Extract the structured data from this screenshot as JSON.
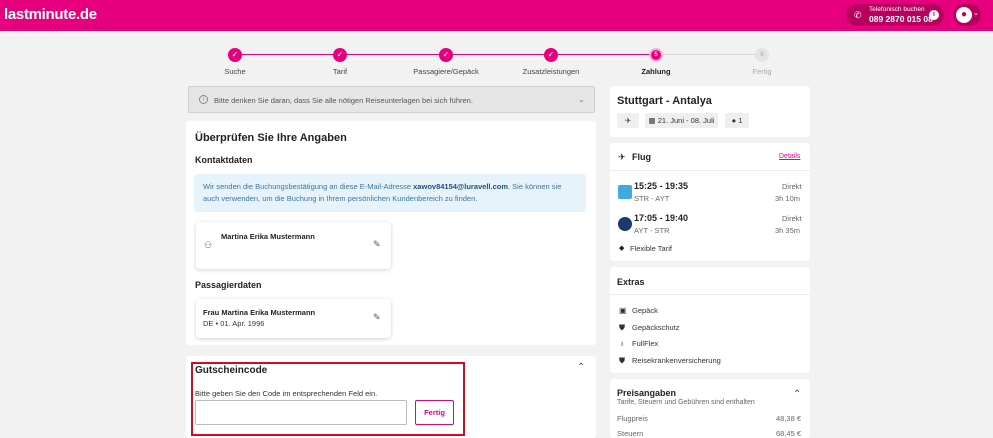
{
  "header": {
    "logo": "lastminute.de",
    "phone_label": "Telefonisch buchen",
    "phone_number": "089 2870 015 08"
  },
  "steps": [
    {
      "label": "Suche",
      "symbol": "✓"
    },
    {
      "label": "Tarif",
      "symbol": "✓"
    },
    {
      "label": "Passagiere/Gepäck",
      "symbol": "✓"
    },
    {
      "label": "Zusatzleistungen",
      "symbol": "✓"
    },
    {
      "label": "Zahlung",
      "symbol": "5"
    },
    {
      "label": "Fertig",
      "symbol": "6"
    }
  ],
  "notice": {
    "text": "Bitte denken Sie daran, dass Sie alle nötigen Reiseunterlagen bei sich führen."
  },
  "review": {
    "title": "Überprüfen Sie Ihre Angaben",
    "contact_title": "Kontaktdaten",
    "email_prefix": "Wir senden die Buchungsbestätigung an diese E-Mail-Adresse",
    "email": "xawov84154@luravell.com",
    "email_suffix": ". Sie können sie auch verwenden, um die Buchung in Ihrem persönlichen Kundenbereich zu finden.",
    "contact_name": "Martina Erika Mustermann",
    "passenger_title": "Passagierdaten",
    "passenger_name": "Frau Martina Erika Mustermann",
    "passenger_info": "DE • 01. Apr. 1996"
  },
  "voucher": {
    "title": "Gutscheincode",
    "hint": "Bitte geben Sie den Code im entsprechenden Feld ein.",
    "input_value": "",
    "button_label": "Fertig"
  },
  "trip": {
    "route": "Stuttgart - Antalya",
    "dates": "21. Juni - 08. Juli",
    "travelers": "1"
  },
  "flight": {
    "title": "Flug",
    "details_link": "Details",
    "legs": [
      {
        "time": "15:25 - 19:35",
        "route": "STR - AYT",
        "type": "Direkt",
        "duration": "3h 10m"
      },
      {
        "time": "17:05 - 19:40",
        "route": "AYT - STR",
        "type": "Direkt",
        "duration": "3h 35m"
      }
    ],
    "tariff": "Flexible Tarif"
  },
  "extras": {
    "title": "Extras",
    "items": [
      {
        "label": "Gepäck",
        "icon": "luggage-icon"
      },
      {
        "label": "Gepäckschutz",
        "icon": "shield-icon"
      },
      {
        "label": "FullFlex",
        "icon": "flex-icon"
      },
      {
        "label": "Reisekrankenversicherung",
        "icon": "shield-icon"
      }
    ]
  },
  "prices": {
    "title": "Preisangaben",
    "subtitle": "Tarife, Steuern und Gebühren sind enthalten",
    "rows": [
      {
        "label": "Flugpreis",
        "value": "48,38 €"
      },
      {
        "label": "Steuern",
        "value": "68,45 €"
      }
    ]
  },
  "colors": {
    "brand": "#e6007e",
    "highlight": "#d40b1f",
    "info_bg": "#e7f3fb"
  }
}
